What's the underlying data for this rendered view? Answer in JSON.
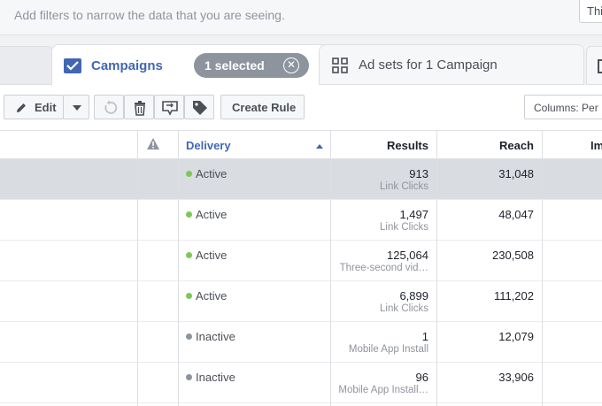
{
  "filter_bar": {
    "placeholder": "Add filters to narrow the data that you are seeing.",
    "right_button": "Thi"
  },
  "tabs": {
    "campaigns": {
      "label": "Campaigns",
      "selected_badge": "1 selected",
      "clear_icon": "⊗"
    },
    "ad_sets": {
      "label": "Ad sets for 1 Campaign"
    }
  },
  "toolbar": {
    "edit_label": "Edit",
    "create_rule_label": "Create Rule",
    "columns_label": "Columns: Per"
  },
  "table": {
    "headers": {
      "delivery": "Delivery",
      "results": "Results",
      "reach": "Reach",
      "impressions": "Im"
    },
    "rows": [
      {
        "status": "Active",
        "status_color": "#7ec857",
        "results": "913",
        "result_type": "Link Clicks",
        "reach": "31,048",
        "selected": true
      },
      {
        "status": "Active",
        "status_color": "#7ec857",
        "results": "1,497",
        "result_type": "Link Clicks",
        "reach": "48,047",
        "selected": false
      },
      {
        "status": "Active",
        "status_color": "#7ec857",
        "results": "125,064",
        "result_type": "Three-second vid…",
        "reach": "230,508",
        "selected": false
      },
      {
        "status": "Active",
        "status_color": "#7ec857",
        "results": "6,899",
        "result_type": "Link Clicks",
        "reach": "111,202",
        "selected": false
      },
      {
        "status": "Inactive",
        "status_color": "#8d949e",
        "results": "1",
        "result_type": "Mobile App Install",
        "reach": "12,079",
        "selected": false
      },
      {
        "status": "Inactive",
        "status_color": "#8d949e",
        "results": "96",
        "result_type": "Mobile App Install…",
        "reach": "33,906",
        "selected": false
      }
    ]
  },
  "colors": {
    "accent": "#4267b2",
    "active": "#7ec857",
    "inactive": "#8d949e",
    "selected_row": "#d9dce1"
  }
}
